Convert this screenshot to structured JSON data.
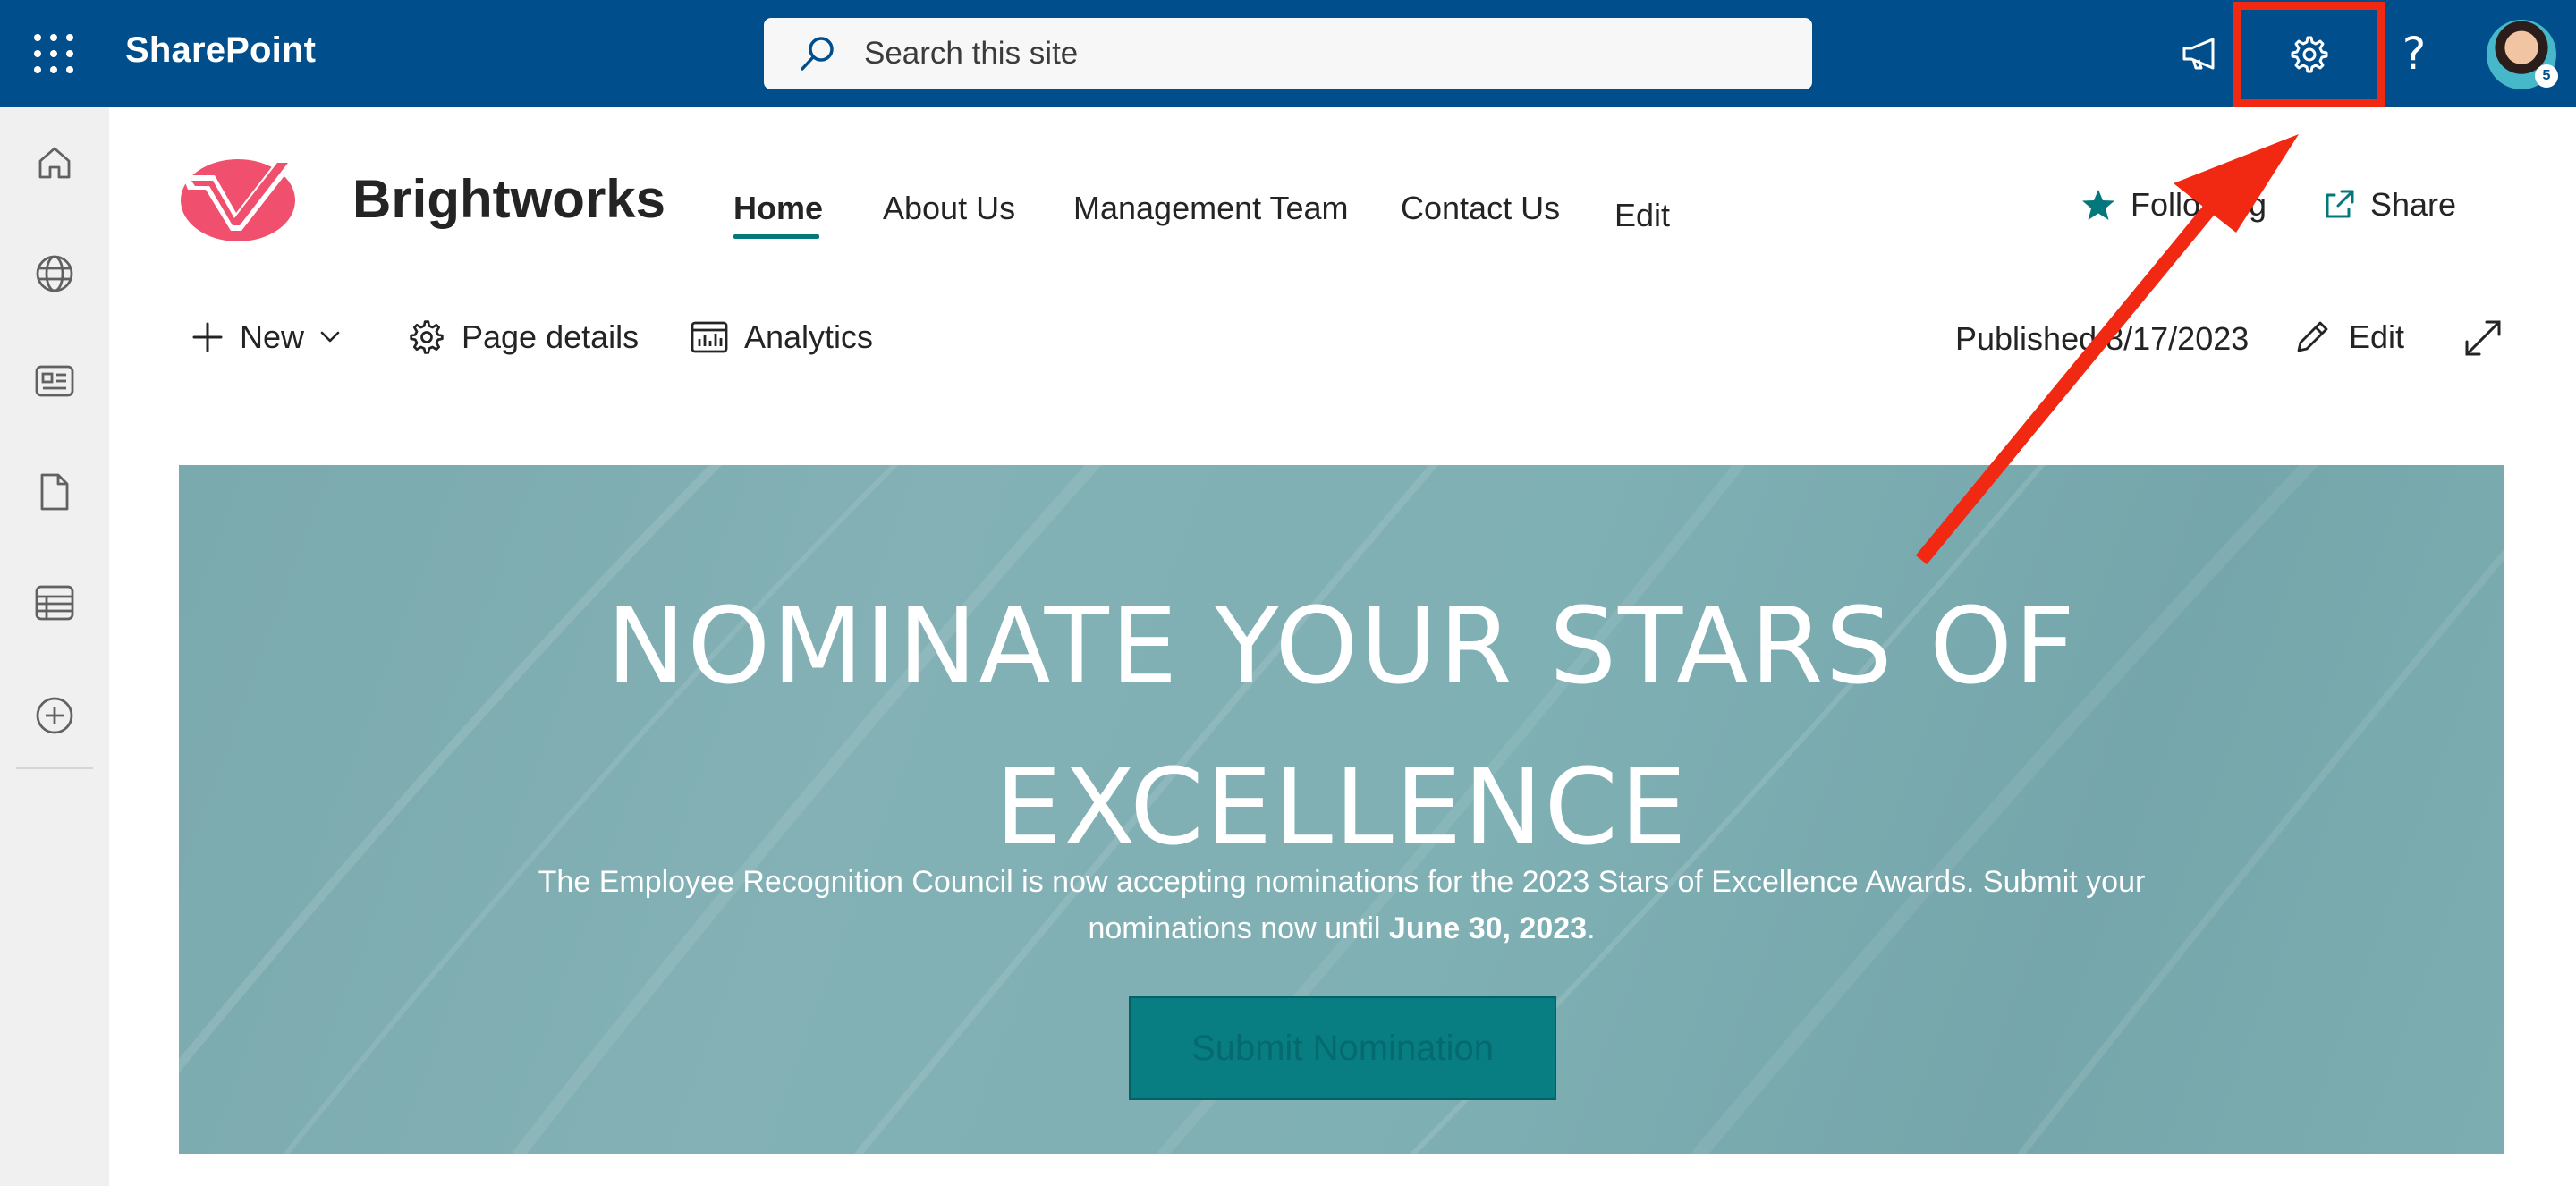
{
  "suite_bar": {
    "app_name": "SharePoint",
    "search_placeholder": "Search this site",
    "help_label": "?",
    "avatar_badge": "5"
  },
  "site": {
    "title": "Brightworks",
    "nav": [
      {
        "label": "Home",
        "active": true
      },
      {
        "label": "About Us"
      },
      {
        "label": "Management Team"
      },
      {
        "label": "Contact Us"
      }
    ],
    "nav_edit": "Edit",
    "following_label": "Following",
    "share_label": "Share"
  },
  "command_bar": {
    "new_label": "New",
    "page_details_label": "Page details",
    "analytics_label": "Analytics",
    "published": "Published 8/17/2023",
    "edit_label": "Edit"
  },
  "hero": {
    "title_line1": "NOMINATE YOUR STARS OF",
    "title_line2": "EXCELLENCE",
    "description_part1": "The Employee Recognition Council is now accepting nominations for the 2023 Stars of Excellence Awards. Submit your nominations now until ",
    "description_bold": "June 30, 2023",
    "description_end": ".",
    "button_label": "Submit Nomination"
  },
  "colors": {
    "suite_bar": "#004e8c",
    "accent_teal": "#03787c",
    "highlight_red": "#f12812",
    "logo_pink": "#f0506e"
  },
  "icons": [
    "waffle-icon",
    "search-icon",
    "megaphone-icon",
    "gear-icon",
    "help-icon",
    "home-icon",
    "globe-icon",
    "news-icon",
    "document-icon",
    "list-icon",
    "add-circle-icon",
    "star-icon",
    "share-icon",
    "plus-icon",
    "chevron-down-icon",
    "analytics-icon",
    "pencil-icon",
    "expand-icon"
  ]
}
